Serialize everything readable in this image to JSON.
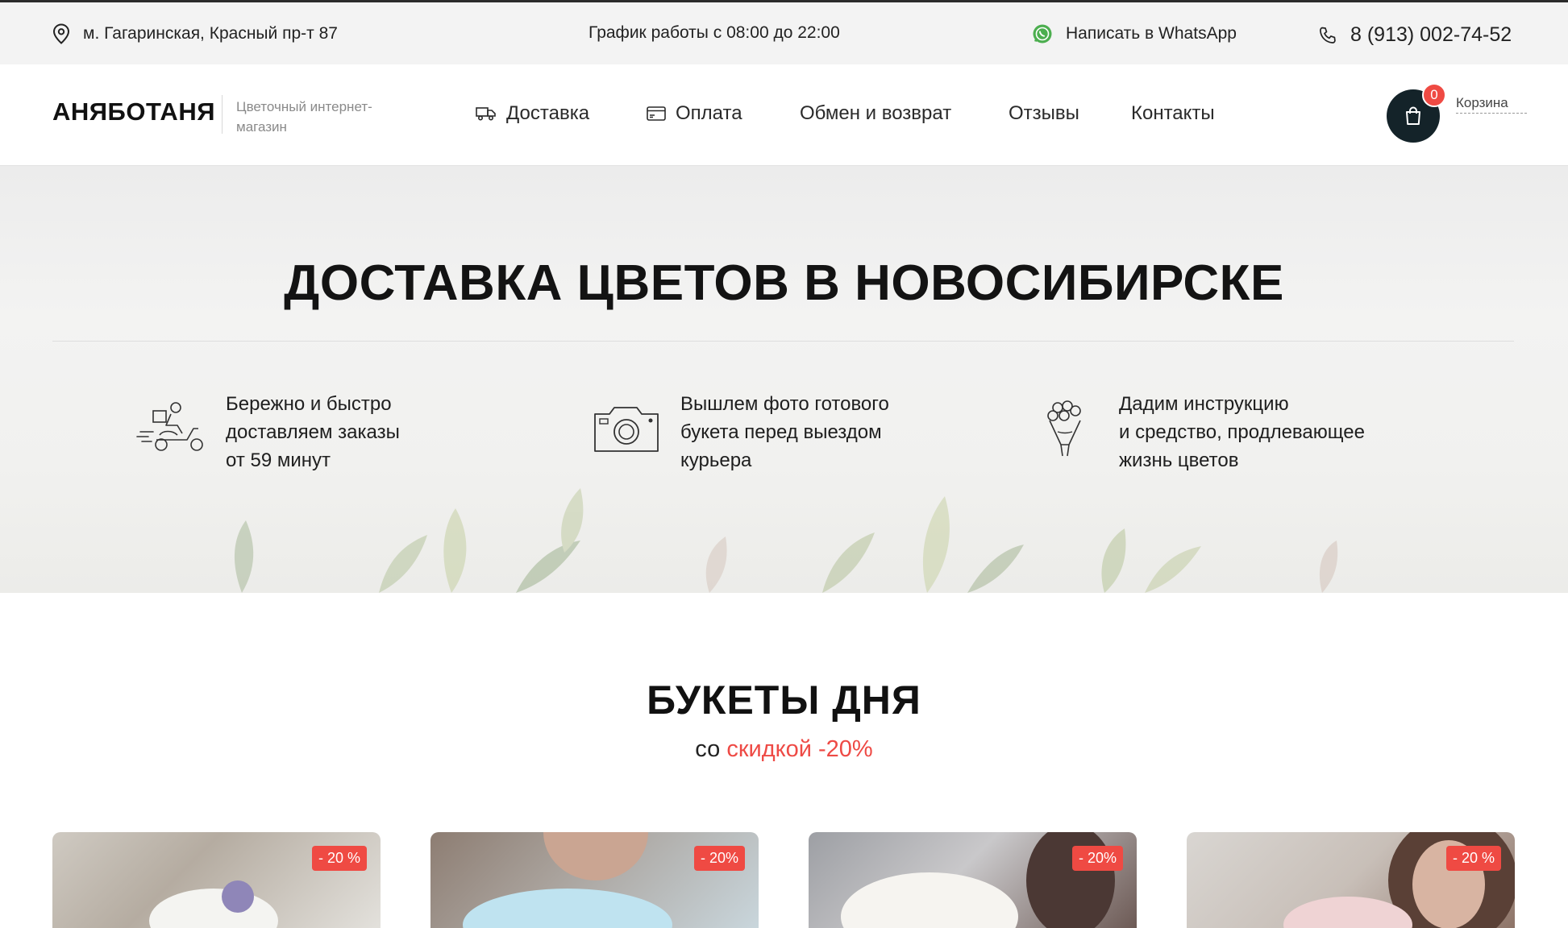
{
  "topbar": {
    "address": "м. Гагаринская, Красный пр-т 87",
    "schedule": "График работы с 08:00 до 22:00",
    "whatsapp": "Написать в WhatsApp",
    "phone": "8 (913) 002-74-52",
    "colors": {
      "whatsapp_icon": "#4cae4f"
    }
  },
  "header": {
    "logo": "АНЯБОТАНЯ",
    "tagline": "Цветочный интернет-магазин",
    "nav": [
      {
        "label": "Доставка",
        "icon": "truck-icon"
      },
      {
        "label": "Оплата",
        "icon": "card-icon"
      },
      {
        "label": "Обмен и возврат"
      },
      {
        "label": "Отзывы"
      },
      {
        "label": "Контакты"
      }
    ],
    "cart": {
      "count": "0",
      "label": "Корзина",
      "icon": "shopping-bag-icon"
    },
    "colors": {
      "cart_bg": "#142329",
      "badge": "#ef4a43"
    }
  },
  "hero": {
    "title": "ДОСТАВКА ЦВЕТОВ В НОВОСИБИРСКЕ",
    "features": [
      {
        "icon": "courier-scooter-icon",
        "text": "Бережно и быстро\nдоставляем заказы\nот 59 минут"
      },
      {
        "icon": "camera-icon",
        "text": "Вышлем фото готового\nбукета перед выездом\nкурьера"
      },
      {
        "icon": "bouquet-icon",
        "text": "Дадим инструкцию\nи средство, продлевающее\nжизнь цветов"
      }
    ]
  },
  "bouquets": {
    "title": "БУКЕТЫ ДНЯ",
    "subtitle_prefix": "со",
    "subtitle_accent": "скидкой -20%",
    "accent_color": "#ee4a45",
    "cards": [
      {
        "badge": "- 20 %"
      },
      {
        "badge": "- 20%"
      },
      {
        "badge": "- 20%"
      },
      {
        "badge": "- 20 %"
      }
    ]
  }
}
